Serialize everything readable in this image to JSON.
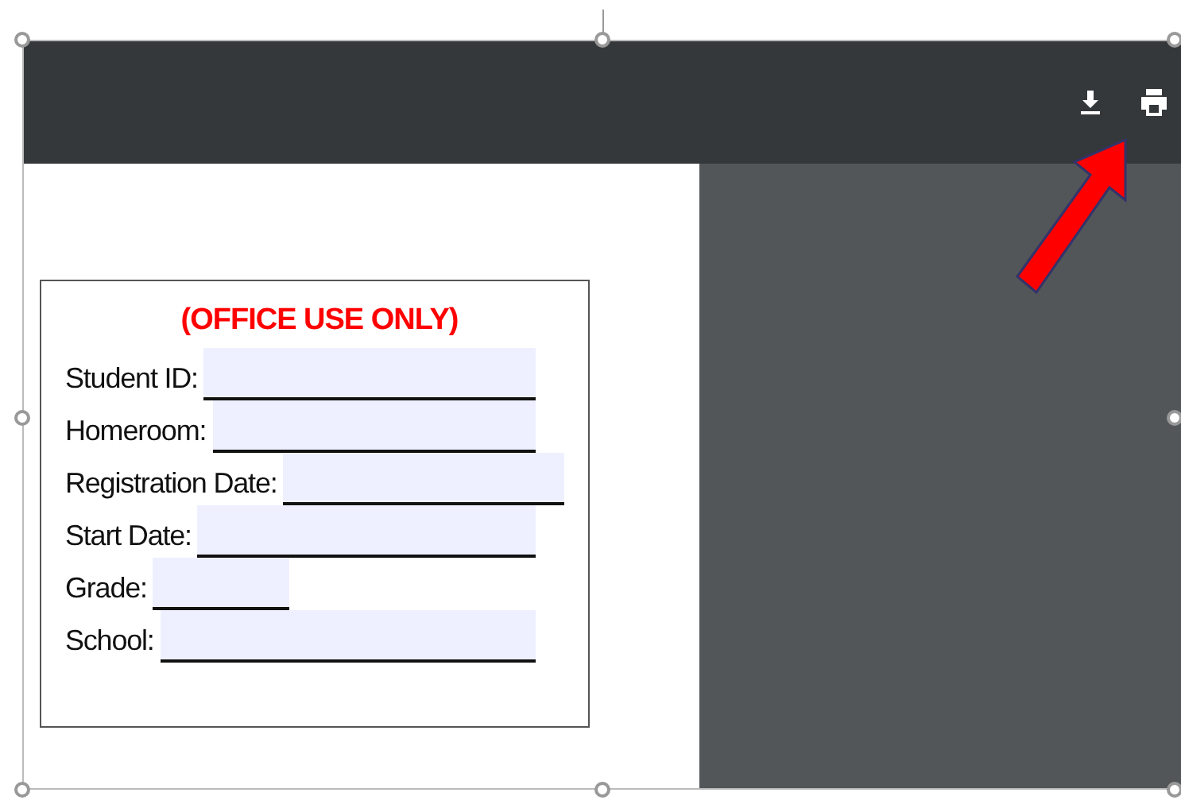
{
  "form": {
    "title": "(OFFICE USE ONLY)",
    "fields": [
      {
        "label": "Student ID:",
        "short": false
      },
      {
        "label": "Homeroom:",
        "short": false
      },
      {
        "label": "Registration Date:",
        "short": false
      },
      {
        "label": "Start Date:",
        "short": false
      },
      {
        "label": "Grade:",
        "short": true
      },
      {
        "label": "School:",
        "short": false
      }
    ]
  }
}
